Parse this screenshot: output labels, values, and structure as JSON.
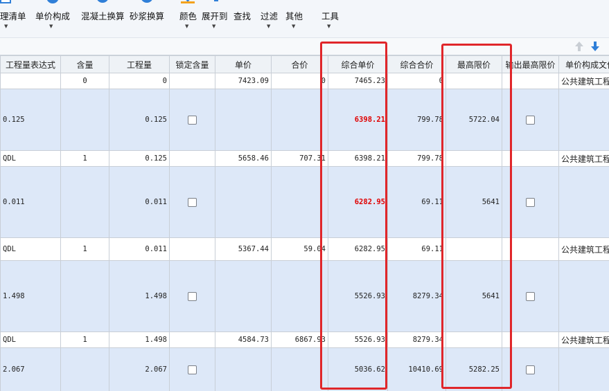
{
  "toolbar": {
    "items": [
      {
        "label": "理清单",
        "icon": "list-icon"
      },
      {
        "label": "单价构成",
        "icon": "price-structure-icon"
      },
      {
        "label": "混凝土换算",
        "icon": "concrete-icon"
      },
      {
        "label": "砂浆换算",
        "icon": "mortar-icon"
      },
      {
        "label": "颜色",
        "icon": "color-icon"
      },
      {
        "label": "展开到",
        "icon": "expand-icon"
      },
      {
        "label": "查找",
        "icon": "find-icon"
      },
      {
        "label": "过滤",
        "icon": "filter-icon"
      },
      {
        "label": "其他",
        "icon": "other-icon"
      },
      {
        "label": "工具",
        "icon": "tools-icon"
      }
    ]
  },
  "colors": {
    "highlight": "#e0262a",
    "alt_row": "#dde8f8",
    "red_value": "#e00000"
  },
  "columns": [
    "工程量表达式",
    "含量",
    "工程量",
    "锁定含量",
    "单价",
    "合价",
    "综合单价",
    "综合合价",
    "最高限价",
    "输出最高限价",
    "单价构成文件"
  ],
  "rows": [
    {
      "expr": "",
      "content": "0",
      "qty": "0",
      "unit_price": "7423.09",
      "total": "0",
      "comp_price": "7465.23",
      "comp_total": "0",
      "max_price": "",
      "file": "公共建筑工程",
      "check": false,
      "red": false
    },
    {
      "expr": "0.125",
      "content": "",
      "qty": "0.125",
      "unit_price": "",
      "total": "",
      "comp_price": "6398.21",
      "comp_total": "799.78",
      "max_price": "5722.04",
      "file": "",
      "check": true,
      "red": true
    },
    {
      "expr": "QDL",
      "content": "1",
      "qty": "0.125",
      "unit_price": "5658.46",
      "total": "707.31",
      "comp_price": "6398.21",
      "comp_total": "799.78",
      "max_price": "",
      "file": "公共建筑工程",
      "check": false,
      "red": false
    },
    {
      "expr": "0.011",
      "content": "",
      "qty": "0.011",
      "unit_price": "",
      "total": "",
      "comp_price": "6282.95",
      "comp_total": "69.11",
      "max_price": "5641",
      "file": "",
      "check": true,
      "red": true
    },
    {
      "expr": "QDL",
      "content": "1",
      "qty": "0.011",
      "unit_price": "5367.44",
      "total": "59.04",
      "comp_price": "6282.95",
      "comp_total": "69.11",
      "max_price": "",
      "file": "公共建筑工程",
      "check": false,
      "red": false
    },
    {
      "expr": "1.498",
      "content": "",
      "qty": "1.498",
      "unit_price": "",
      "total": "",
      "comp_price": "5526.93",
      "comp_total": "8279.34",
      "max_price": "5641",
      "file": "",
      "check": true,
      "red": false
    },
    {
      "expr": "QDL",
      "content": "1",
      "qty": "1.498",
      "unit_price": "4584.73",
      "total": "6867.93",
      "comp_price": "5526.93",
      "comp_total": "8279.34",
      "max_price": "",
      "file": "公共建筑工程",
      "check": false,
      "red": false
    },
    {
      "expr": "2.067",
      "content": "",
      "qty": "2.067",
      "unit_price": "",
      "total": "",
      "comp_price": "5036.62",
      "comp_total": "10410.69",
      "max_price": "5282.25",
      "file": "",
      "check": true,
      "red": false
    }
  ]
}
